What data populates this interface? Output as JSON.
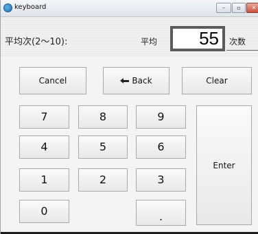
{
  "window": {
    "title": "keyboard",
    "controls": {
      "minimize": "–",
      "maximize": "▫",
      "close": "✕"
    }
  },
  "header": {
    "count_label": "平均次(2～10):",
    "average_label": "平均",
    "value": "55",
    "unit_label": "次数"
  },
  "keypad": {
    "cancel": "Cancel",
    "back": "Back",
    "clear": "Clear",
    "digits": [
      "7",
      "8",
      "9",
      "4",
      "5",
      "6",
      "1",
      "2",
      "3",
      "0"
    ],
    "dot": ".",
    "enter": "Enter"
  }
}
